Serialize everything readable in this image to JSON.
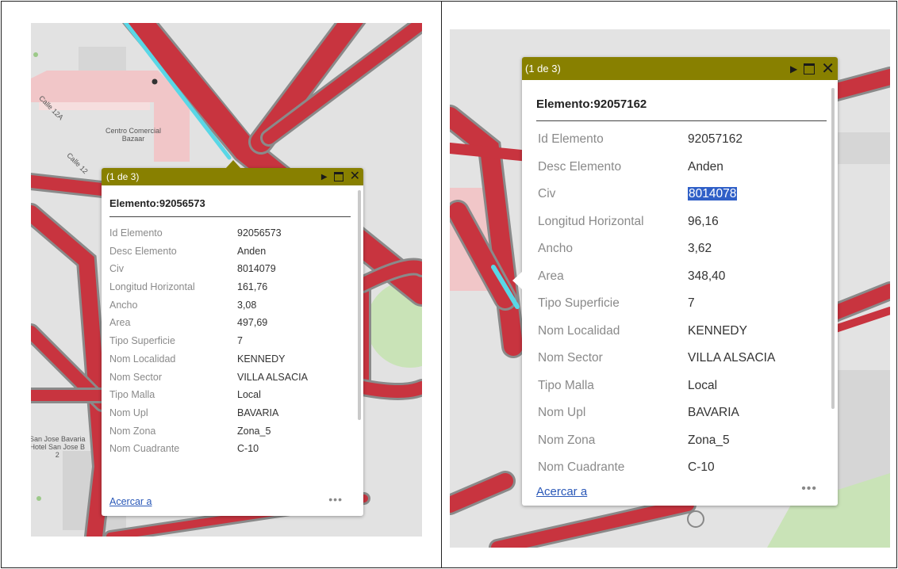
{
  "popups": {
    "left": {
      "count": "(1 de 3)",
      "title": "Elemento:92056573",
      "attrs": [
        {
          "k": "Id Elemento",
          "v": "92056573"
        },
        {
          "k": "Desc Elemento",
          "v": "Anden"
        },
        {
          "k": "Civ",
          "v": "8014079"
        },
        {
          "k": "Longitud Horizontal",
          "v": "161,76"
        },
        {
          "k": "Ancho",
          "v": "3,08"
        },
        {
          "k": "Area",
          "v": "497,69"
        },
        {
          "k": "Tipo Superficie",
          "v": "7"
        },
        {
          "k": "Nom Localidad",
          "v": "KENNEDY"
        },
        {
          "k": "Nom Sector",
          "v": "VILLA ALSACIA"
        },
        {
          "k": "Tipo Malla",
          "v": "Local"
        },
        {
          "k": "Nom Upl",
          "v": "BAVARIA"
        },
        {
          "k": "Nom Zona",
          "v": "Zona_5"
        },
        {
          "k": "Nom Cuadrante",
          "v": "C-10"
        }
      ],
      "zoom_link": "Acercar a",
      "more": "•••"
    },
    "right": {
      "count": "(1 de 3)",
      "title": "Elemento:92057162",
      "attrs": [
        {
          "k": "Id Elemento",
          "v": "92057162"
        },
        {
          "k": "Desc Elemento",
          "v": "Anden"
        },
        {
          "k": "Civ",
          "v": "8014078"
        },
        {
          "k": "Longitud Horizontal",
          "v": "96,16"
        },
        {
          "k": "Ancho",
          "v": "3,62"
        },
        {
          "k": "Area",
          "v": "348,40"
        },
        {
          "k": "Tipo Superficie",
          "v": "7"
        },
        {
          "k": "Nom Localidad",
          "v": "KENNEDY"
        },
        {
          "k": "Nom Sector",
          "v": "VILLA ALSACIA"
        },
        {
          "k": "Tipo Malla",
          "v": "Local"
        },
        {
          "k": "Nom Upl",
          "v": "BAVARIA"
        },
        {
          "k": "Nom Zona",
          "v": "Zona_5"
        },
        {
          "k": "Nom Cuadrante",
          "v": "C-10"
        }
      ],
      "zoom_link": "Acercar a",
      "more": "•••",
      "selected_value": "8014078"
    }
  },
  "map_labels": {
    "street_a": "Calle 12A",
    "street_b": "Calle 12",
    "mall_line1": "Centro Comercial",
    "mall_line2": "Bazaar",
    "poi_line1": "San Jose Bavaria",
    "poi_line2": "Hotel San Jose B",
    "poi_line3": "2"
  },
  "colors": {
    "header": "#888000",
    "road": "#c8343f",
    "road_outline": "#8a8a8a",
    "highlight": "#59d7e6",
    "park": "#c9e3b7",
    "link": "#2a58b8"
  },
  "icons": {
    "next": "play-icon",
    "maximize": "maximize-icon",
    "close": "close-icon"
  }
}
